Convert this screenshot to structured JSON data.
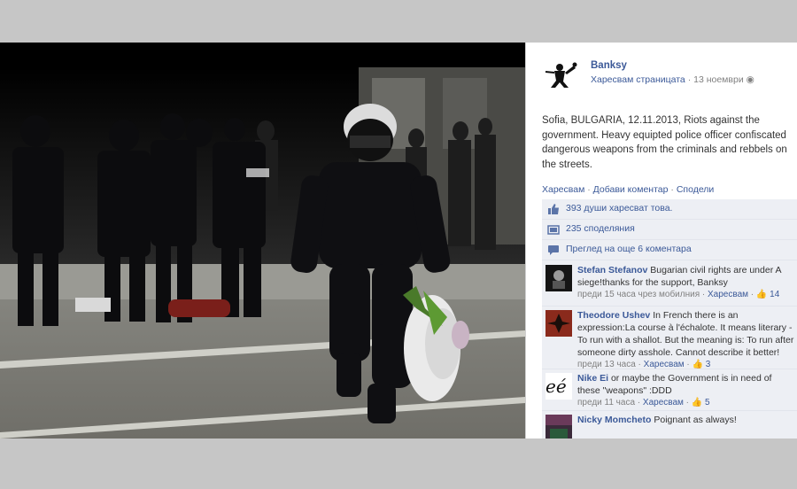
{
  "post": {
    "page_name": "Banksy",
    "like_page": "Харесвам страницата",
    "date": "13 ноември",
    "text": "Sofia, BULGARIA, 12.11.2013, Riots against the government. Heavy equipted police officer confiscated dangerous weapons from the criminals and rebbels on the streets.",
    "actions": {
      "like": "Харесвам",
      "comment": "Добави коментар",
      "share": "Сподели"
    }
  },
  "ufi": {
    "likes": "393 души харесват това.",
    "shares": "235 споделяния",
    "more_comments": "Преглед на още 6 коментара"
  },
  "comments": [
    {
      "author": "Stefan Stefanov",
      "text": "Bugarian civil rights are under A siege!thanks for the support, Banksy",
      "time": "преди 15 часа чрез мобилния",
      "like": "Харесвам",
      "likes": "14"
    },
    {
      "author": "Theodore Ushev",
      "text": "In French there is an expression:La course à l'échalote. It means literary - To run with a shallot. But the meaning is: To run after someone dirty asshole. Cannot describe it better!",
      "time": "преди 13 часа",
      "like": "Харесвам",
      "likes": "3"
    },
    {
      "author": "Nike Ei",
      "text": "or maybe the Government is in need of these \"weapons\" :DDD",
      "time": "преди 11 часа",
      "like": "Харесвам",
      "likes": "5"
    },
    {
      "author": "Nicky Momcheto",
      "text": "Poignant as always!",
      "time": "",
      "like": "",
      "likes": ""
    }
  ],
  "avatar_glyphs": {
    "nike": "eé"
  },
  "colors": {
    "fb_blue": "#3b5998",
    "ufi_bg": "#edeff4",
    "frame_bg": "#c6c6c6"
  }
}
